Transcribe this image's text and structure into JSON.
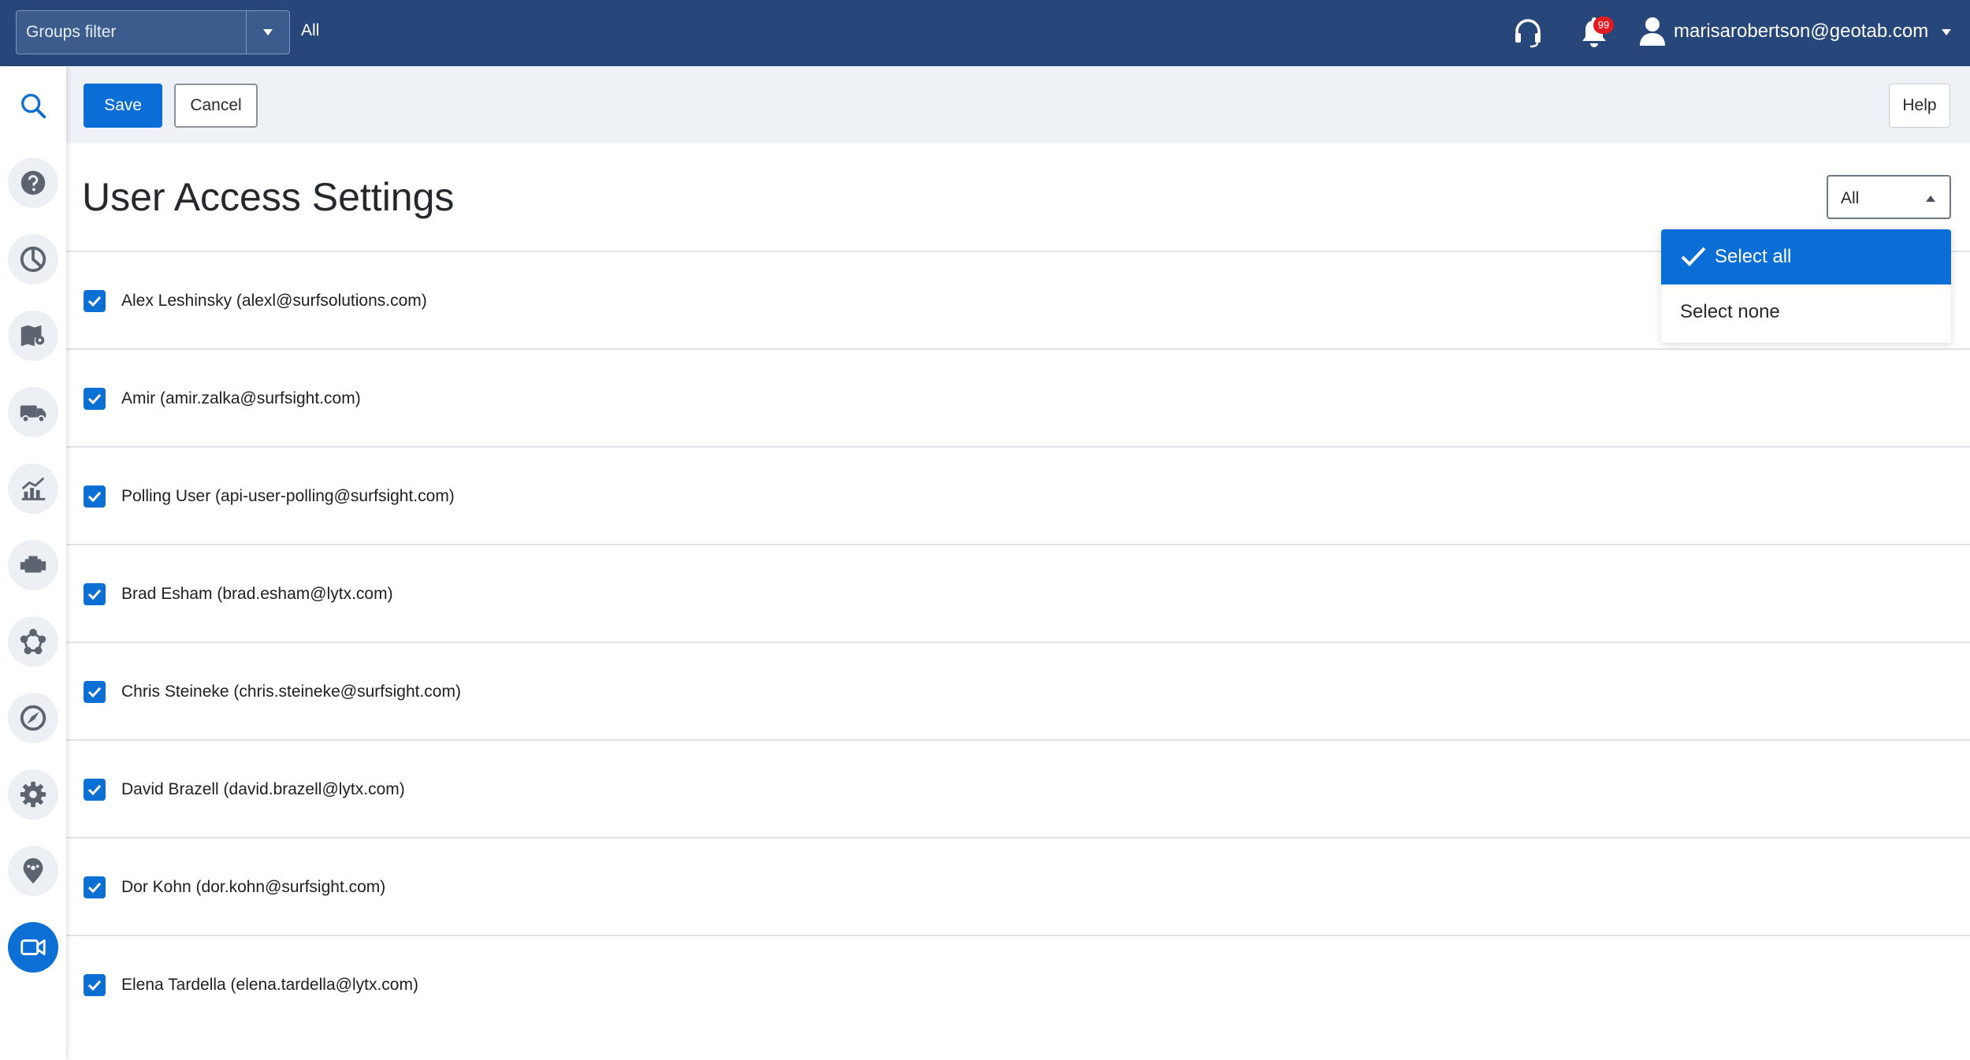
{
  "topbar": {
    "groups_filter_label": "Groups filter",
    "groups_filter_value": "All",
    "notification_count": "99",
    "user_email": "marisarobertson@geotab.com"
  },
  "sidebar": {
    "items": [
      {
        "name": "search",
        "icon": "search-icon"
      },
      {
        "name": "help",
        "icon": "question-icon"
      },
      {
        "name": "dashboard",
        "icon": "pie-chart-icon"
      },
      {
        "name": "map",
        "icon": "map-icon"
      },
      {
        "name": "vehicles",
        "icon": "truck-icon"
      },
      {
        "name": "reports",
        "icon": "chart-icon"
      },
      {
        "name": "engine",
        "icon": "engine-icon"
      },
      {
        "name": "rules",
        "icon": "network-icon"
      },
      {
        "name": "productivity",
        "icon": "compass-icon"
      },
      {
        "name": "settings",
        "icon": "gear-icon"
      },
      {
        "name": "zones",
        "icon": "location-icon"
      },
      {
        "name": "video",
        "icon": "video-camera-icon",
        "active": true
      }
    ]
  },
  "toolbar": {
    "save_label": "Save",
    "cancel_label": "Cancel",
    "help_label": "Help"
  },
  "main": {
    "title": "User Access Settings",
    "filter_select_value": "All",
    "dropdown_options": [
      "Select all",
      "Select none"
    ],
    "users": [
      {
        "label": "Alex Leshinsky (alexl@surfsolutions.com)",
        "checked": true
      },
      {
        "label": "Amir (amir.zalka@surfsight.com)",
        "checked": true
      },
      {
        "label": "Polling User (api-user-polling@surfsight.com)",
        "checked": true
      },
      {
        "label": "Brad Esham (brad.esham@lytx.com)",
        "checked": true
      },
      {
        "label": "Chris Steineke (chris.steineke@surfsight.com)",
        "checked": true
      },
      {
        "label": "David Brazell (david.brazell@lytx.com)",
        "checked": true
      },
      {
        "label": "Dor Kohn (dor.kohn@surfsight.com)",
        "checked": true
      },
      {
        "label": "Elena Tardella (elena.tardella@lytx.com)",
        "checked": true
      }
    ]
  },
  "colors": {
    "header_bg": "#27477a",
    "accent": "#0b6ed6",
    "badge": "#e21b23",
    "toolbar_bg": "#eef1f6"
  }
}
